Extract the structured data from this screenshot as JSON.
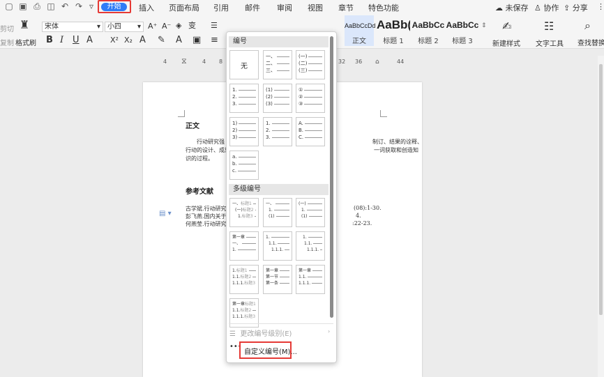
{
  "quick_access": {
    "icons": [
      "window-icon",
      "save-icon",
      "print-icon",
      "print-preview-icon",
      "undo-icon",
      "redo-icon",
      "customize-icon"
    ]
  },
  "menu": {
    "start": "开始",
    "tabs": [
      "插入",
      "页面布局",
      "引用",
      "邮件",
      "审阅",
      "视图",
      "章节",
      "特色功能"
    ]
  },
  "topright": {
    "unsaved": "未保存",
    "collab": "协作",
    "share": "分享"
  },
  "ribbon": {
    "cut": "剪切",
    "copy": "复制",
    "format_painter": "格式刷",
    "font_name": "宋体",
    "font_size": "小四",
    "styles": [
      {
        "sample": "AaBbCcDd",
        "label": "正文"
      },
      {
        "sample": "AaBb(",
        "label": "标题 1"
      },
      {
        "sample": "AaBbCc",
        "label": "标题 2"
      },
      {
        "sample": "AaBbCc",
        "label": "标题 3"
      }
    ],
    "new_style": "新建样式",
    "text_tools": "文字工具",
    "find_replace": "查找替换"
  },
  "ruler": [
    "4",
    "4",
    "8",
    "32",
    "36",
    "44"
  ],
  "document": {
    "heading1": "正文",
    "para_line1": "行动研究强",
    "para_line1_tail": "制订、结果的诠释、",
    "para_line2": "行动的设计、成果",
    "para_line2_tail": "一词获取和创造知",
    "para_line3": "识的过程。",
    "heading2": "参考文献",
    "refs": [
      "古学斌.行动研究",
      "彭飞燕.国内关于",
      "何燕莹.行动研究"
    ],
    "refs_tail": [
      "(08):1-30.",
      "4.",
      ":22-23."
    ]
  },
  "panel": {
    "section_numbering": "编号",
    "none_label": "无",
    "single_lists": [
      [
        "一、",
        "二、",
        "三、"
      ],
      [
        "(一)",
        "(二)",
        "(三)"
      ],
      [
        "1.",
        "2.",
        "3."
      ],
      [
        "(1)",
        "(2)",
        "(3)"
      ],
      [
        "①",
        "②",
        "③"
      ],
      [
        "1)",
        "2)",
        "3)"
      ],
      [
        "1.",
        "2.",
        "3."
      ],
      [
        "A.",
        "B.",
        "C."
      ],
      [
        "a.",
        "b.",
        "c."
      ]
    ],
    "section_multilevel": "多级编号",
    "multi_lists": [
      [
        [
          "一、",
          "标题1"
        ],
        [
          "(一)",
          "标题2"
        ],
        [
          "1.",
          "标题3"
        ]
      ],
      [
        [
          "一、",
          ""
        ],
        [
          "1.",
          ""
        ],
        [
          "(1)",
          ""
        ]
      ],
      [
        [
          "(一)",
          ""
        ],
        [
          "1.",
          ""
        ],
        [
          "(1)",
          ""
        ]
      ],
      [
        [
          "第一章",
          ""
        ],
        [
          "一、",
          ""
        ],
        [
          "1.",
          ""
        ]
      ],
      [
        [
          "1.",
          ""
        ],
        [
          "1.1.",
          ""
        ],
        [
          "1.1.1.",
          ""
        ]
      ],
      [
        [
          "1.",
          ""
        ],
        [
          "1.1.",
          ""
        ],
        [
          "1.1.1.",
          ""
        ]
      ],
      [
        [
          "1.",
          "标题1"
        ],
        [
          "1.1.",
          "标题2"
        ],
        [
          "1.1.1.",
          "标题3"
        ]
      ],
      [
        [
          "第一章",
          ""
        ],
        [
          "第一节",
          ""
        ],
        [
          "第一条",
          ""
        ]
      ],
      [
        [
          "第一章",
          ""
        ],
        [
          "1.1.",
          ""
        ],
        [
          "1.1.1.",
          ""
        ]
      ],
      [
        [
          "第一章",
          "标题1"
        ],
        [
          "1.1.",
          "标题2"
        ],
        [
          "1.1.1.",
          "标题3"
        ]
      ]
    ],
    "change_level": "更改编号级别(E)",
    "custom": "自定义编号(M)..."
  },
  "colors": {
    "accent": "#2f7cf6",
    "highlight": "#e53935"
  }
}
